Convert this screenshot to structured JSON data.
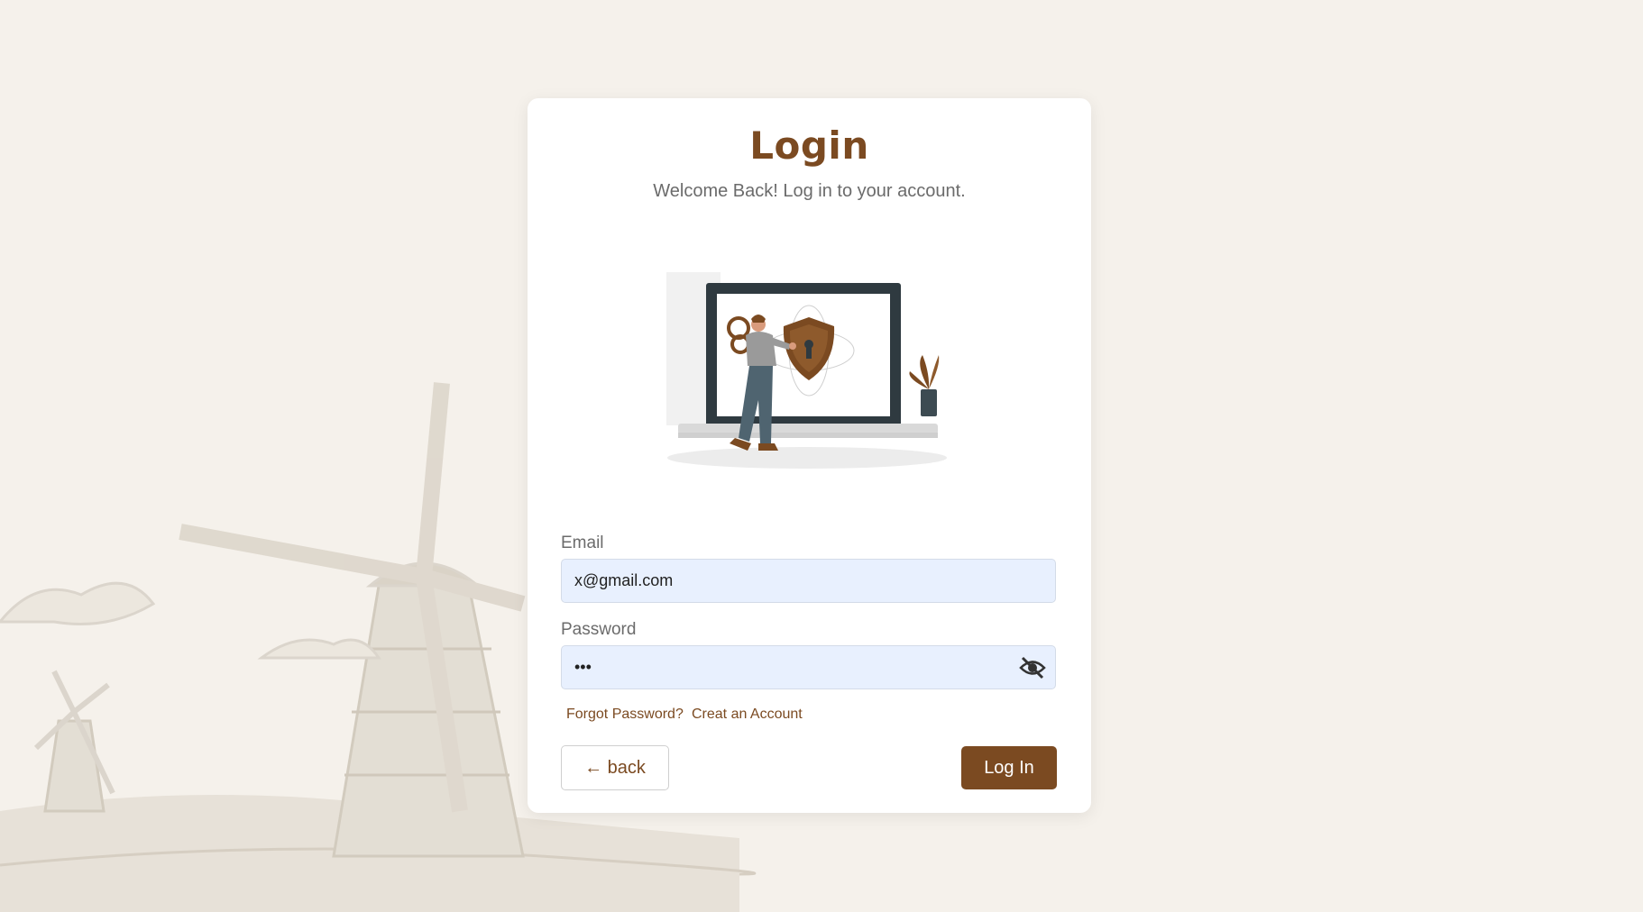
{
  "page": {
    "background_color": "#f5f1eb",
    "accent_color": "#7b4a21"
  },
  "card": {
    "title": "Login",
    "subtitle": "Welcome Back! Log in to your account.",
    "illustration_icon": "laptop-security-illustration"
  },
  "form": {
    "email": {
      "label": "Email",
      "value": "x@gmail.com"
    },
    "password": {
      "label": "Password",
      "value": "•••",
      "toggle_icon": "eye-slash-icon"
    },
    "links": {
      "forgot": "Forgot Password?",
      "create": "Creat an Account"
    },
    "buttons": {
      "back": "← back",
      "login": "Log In"
    }
  }
}
